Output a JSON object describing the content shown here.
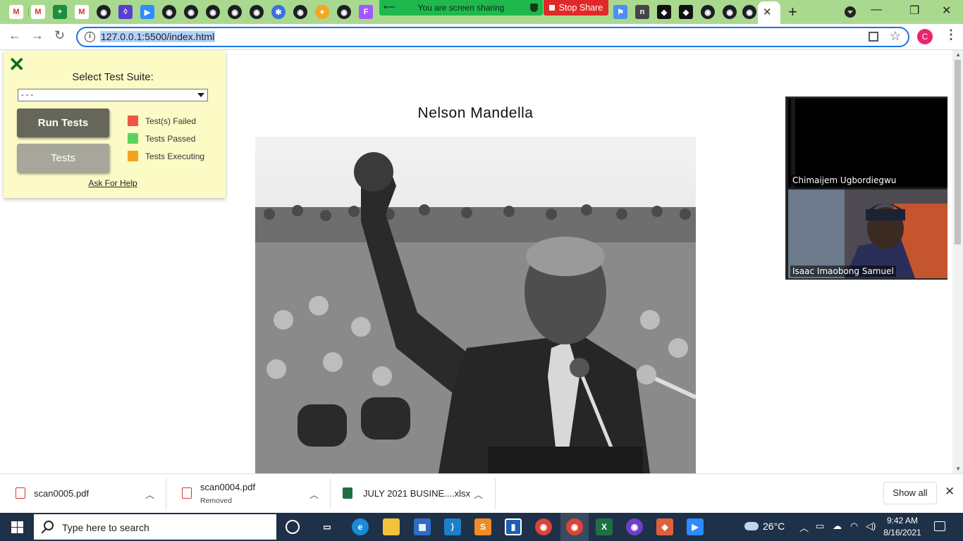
{
  "screen_share": {
    "message": "You are screen sharing",
    "stop_label": "Stop Share"
  },
  "browser": {
    "url": "127.0.0.1:5500/index.html",
    "profile_initial": "C",
    "tab_close": "✕",
    "new_tab": "+"
  },
  "test_panel": {
    "close_symbol": "✕",
    "select_label": "Select Test Suite:",
    "select_value": "- - -",
    "run_button": "Run Tests",
    "tests_button": "Tests",
    "legend": [
      {
        "label": "Test(s) Failed",
        "color": "#f05545"
      },
      {
        "label": "Tests Passed",
        "color": "#5dd35d"
      },
      {
        "label": "Tests Executing",
        "color": "#f5a21e"
      }
    ],
    "help_link": "Ask For Help"
  },
  "page": {
    "heading": "Nelson Mandella"
  },
  "video_call": {
    "participants": [
      {
        "name": "Chimaijem Ugbordiegwu"
      },
      {
        "name": "Isaac Imaobong Samuel"
      }
    ]
  },
  "downloads": {
    "items": [
      {
        "name": "scan0005.pdf",
        "status": "",
        "type": "pdf"
      },
      {
        "name": "scan0004.pdf",
        "status": "Removed",
        "type": "pdf"
      },
      {
        "name": "JULY 2021 BUSINE....xlsx",
        "status": "",
        "type": "xlsx"
      }
    ],
    "show_all": "Show all",
    "close": "✕"
  },
  "taskbar": {
    "search_placeholder": "Type here to search",
    "temperature": "26°C",
    "time": "9:42 AM",
    "date": "8/16/2021"
  },
  "colors": {
    "theme_green": "#a9d98e",
    "share_green": "#1fb84c",
    "stop_red": "#e02828",
    "panel_bg": "#fcfbc6"
  }
}
